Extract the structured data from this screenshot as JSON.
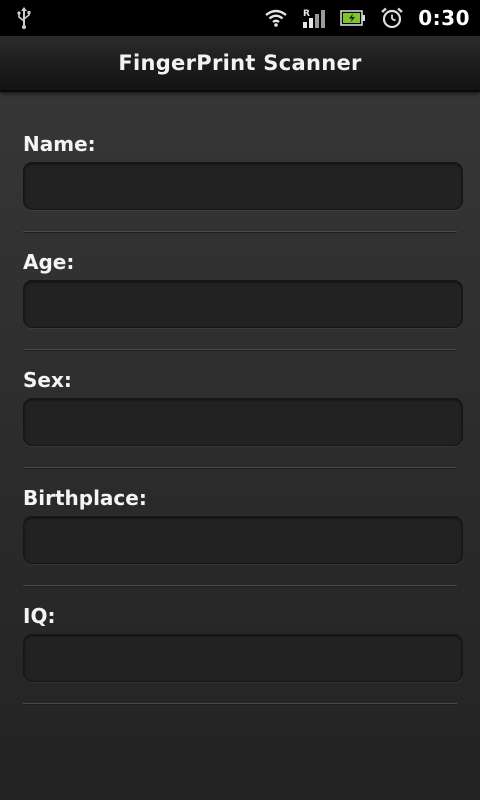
{
  "status_bar": {
    "time": "0:30",
    "icons": [
      "usb-icon",
      "wifi-icon",
      "signal-icon",
      "battery-icon",
      "alarm-icon"
    ]
  },
  "app": {
    "title": "FingerPrint Scanner"
  },
  "form": {
    "fields": [
      {
        "label": "Name:",
        "value": ""
      },
      {
        "label": "Age:",
        "value": ""
      },
      {
        "label": "Sex:",
        "value": ""
      },
      {
        "label": "Birthplace:",
        "value": ""
      },
      {
        "label": "IQ:",
        "value": ""
      }
    ]
  },
  "colors": {
    "status_bar_bg": "#000000",
    "title_bar_bg": "#1c1c1c",
    "screen_bg": "#333333",
    "input_bg": "#222222",
    "text": "#f4f4f4"
  }
}
